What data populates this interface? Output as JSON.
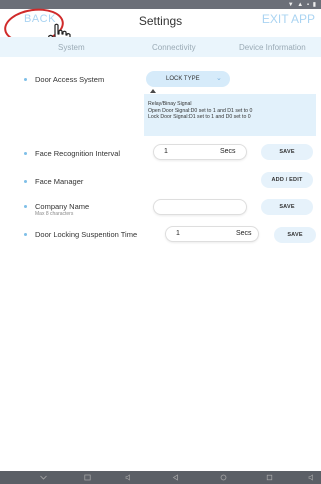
{
  "status_bar": {
    "icons": [
      "notification-icon",
      "wifi-icon",
      "battery-icon"
    ],
    "right_text": "▼ ▲ ▪ ▮"
  },
  "header": {
    "back_label": "BACK",
    "title": "Settings",
    "exit_label": "EXIT APP"
  },
  "tabs": [
    {
      "label": "System"
    },
    {
      "label": "Connectivity"
    },
    {
      "label": "Device Information"
    }
  ],
  "settings": {
    "door_access": {
      "label": "Door Access System",
      "dropdown_label": "LOCK TYPE",
      "info_lines": [
        "Relay/Binay Signal",
        "Open Door Signal:D0 set to 1 and D1 set to 0",
        "Lock Door Signal:D1 set to 1 and D0 set to 0"
      ]
    },
    "face_recognition": {
      "label": "Face Recognition Interval",
      "value": "1",
      "unit": "Secs",
      "button": "SAVE"
    },
    "face_manager": {
      "label": "Face Manager",
      "button": "ADD / EDIT"
    },
    "company_name": {
      "label": "Company Name",
      "sublabel": "Max 8 characters",
      "value": "",
      "button": "SAVE"
    },
    "door_locking": {
      "label": "Door Locking Suspention Time",
      "value": "1",
      "unit": "Secs",
      "button": "SAVE"
    }
  },
  "colors": {
    "accent_light": "#aad4f2",
    "tab_bg": "#eaf5fc",
    "button_bg": "#e6f2fb",
    "annotation_red": "#d02a2a"
  }
}
